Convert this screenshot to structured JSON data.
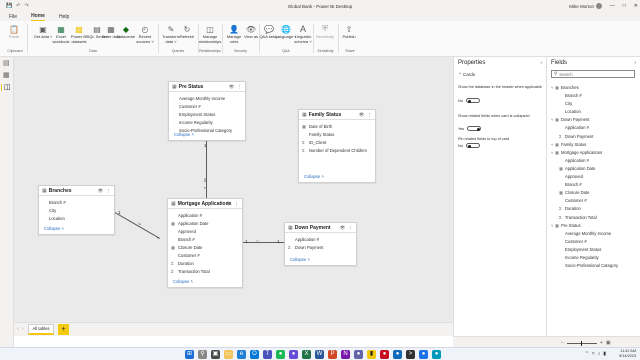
{
  "window": {
    "title": "Global Bank - Power BI Desktop",
    "user": "Mike Morton"
  },
  "menu": [
    {
      "label": "File",
      "active": false
    },
    {
      "label": "Home",
      "active": true
    },
    {
      "label": "Help",
      "active": false
    }
  ],
  "ribbon": {
    "paste": "Paste",
    "get_data": "Get data ˅",
    "excel": "Excel workbook",
    "pbi_datasets": "Power BI datasets",
    "sql_server": "SQL Server",
    "enter_data": "Enter data",
    "dataverse": "Dataverse",
    "recent_sources": "Recent sources ˅",
    "transform_data": "Transform data ˅",
    "refresh": "Refresh",
    "manage_relationships": "Manage relationships",
    "manage_roles": "Manage roles",
    "view_as": "View as",
    "qa_setup": "Q&A setup",
    "language": "Language ˅",
    "linguistic_schema": "Linguistic schema ˅",
    "sensitivity": "Sensitivity",
    "publish": "Publish",
    "groups": {
      "clipboard": "Clipboard",
      "data": "Data",
      "queries": "Queries",
      "relationships": "Relationships",
      "security": "Security",
      "qa": "Q&A",
      "sensitivity": "Sensitivity",
      "share": "Share"
    }
  },
  "canvas": {
    "cards": {
      "pre_status": {
        "title": "Pre Status",
        "fields": [
          "Average Monthly Income",
          "Customer #",
          "Employment Status",
          "Income Regularity",
          "Socio-Professional Category"
        ],
        "collapse": "Collapse ˄"
      },
      "family_status": {
        "title": "Family Status",
        "fields": [
          "Date of Birth",
          "Family Status",
          "ID_Client",
          "Number of Dependent Children"
        ],
        "collapse": "Collapse ˄"
      },
      "branches": {
        "title": "Branches",
        "fields": [
          "Branch #",
          "City",
          "Location"
        ],
        "collapse": "Collapse ˄"
      },
      "mortgage_applications": {
        "title": "Mortgage Applications",
        "fields": [
          "Application #",
          "Application Date",
          "Approved",
          "Branch #",
          "Closure Date",
          "Customer #",
          "Duration",
          "Transaction Total"
        ],
        "collapse": "Collapse ˄"
      },
      "down_payment": {
        "title": "Down Payment",
        "fields": [
          "Application #",
          "Down Payment"
        ],
        "collapse": "Collapse ˄"
      }
    },
    "rel_labels": {
      "one": "1",
      "many": "*"
    }
  },
  "tabs": {
    "active": "All tables",
    "add": "+"
  },
  "properties": {
    "title": "Properties",
    "section": "Cards",
    "opt1": "Show the database in the header when applicable",
    "opt1_state": "No",
    "opt2": "Show related fields when card is collapsed",
    "opt2_state": "Yes",
    "opt3": "Pin related fields to top of card",
    "opt3_state": "No"
  },
  "fields_pane": {
    "title": "Fields",
    "search_placeholder": "Search",
    "tree": [
      {
        "type": "table",
        "label": "Branches"
      },
      {
        "type": "field",
        "label": "Branch #"
      },
      {
        "type": "field",
        "label": "City"
      },
      {
        "type": "field",
        "label": "Location"
      },
      {
        "type": "table",
        "label": "Down Payment"
      },
      {
        "type": "field",
        "label": "Application #"
      },
      {
        "type": "sum",
        "label": "Down Payment"
      },
      {
        "type": "table",
        "label": "Family Status"
      },
      {
        "type": "table",
        "label": "Mortgage Applications"
      },
      {
        "type": "field",
        "label": "Application #"
      },
      {
        "type": "date",
        "label": "Application Date"
      },
      {
        "type": "field",
        "label": "Approved"
      },
      {
        "type": "field",
        "label": "Branch #"
      },
      {
        "type": "date",
        "label": "Closure Date"
      },
      {
        "type": "field",
        "label": "Customer #"
      },
      {
        "type": "sum",
        "label": "Duration"
      },
      {
        "type": "sum",
        "label": "Transaction Total"
      },
      {
        "type": "table",
        "label": "Pre Status"
      },
      {
        "type": "field",
        "label": "Average Monthly Income"
      },
      {
        "type": "field",
        "label": "Customer #"
      },
      {
        "type": "field",
        "label": "Employment Status"
      },
      {
        "type": "field",
        "label": "Income Regularity"
      },
      {
        "type": "field",
        "label": "Socio-Professional Category"
      }
    ]
  },
  "status": {
    "zoom_minus": "−",
    "zoom_plus": "+"
  },
  "taskbar": {
    "time": "11:42 AM",
    "date": "9/14/2023"
  }
}
